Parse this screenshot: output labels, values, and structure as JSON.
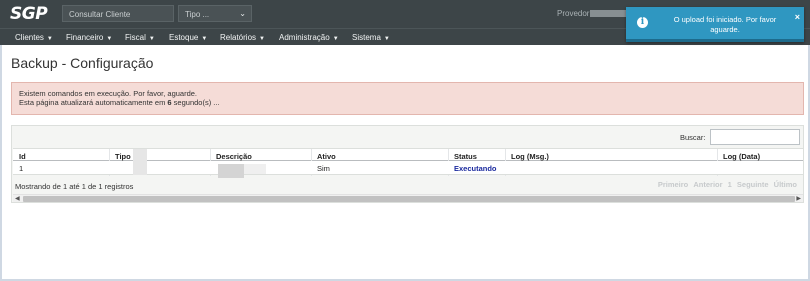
{
  "app": {
    "logo": "SGP",
    "search_placeholder": "Consultar Cliente",
    "tipo_select": "Tipo ...",
    "provedor_label": "Provedor"
  },
  "menu": [
    {
      "label": "Clientes"
    },
    {
      "label": "Financeiro"
    },
    {
      "label": "Fiscal"
    },
    {
      "label": "Estoque"
    },
    {
      "label": "Relatórios"
    },
    {
      "label": "Administração"
    },
    {
      "label": "Sistema"
    }
  ],
  "page": {
    "title": "Backup - Configuração"
  },
  "alert": {
    "line1": "Existem comandos em execução. Por favor, aguarde.",
    "line2_prefix": "Esta página atualizará automaticamente em ",
    "seconds": "6",
    "line2_suffix": " segundo(s) ..."
  },
  "table": {
    "search_label": "Buscar:",
    "columns": [
      "Id",
      "Tipo",
      "Descrição",
      "Ativo",
      "Status",
      "Log (Msg.)",
      "Log (Data)"
    ],
    "rows": [
      {
        "id": "1",
        "tipo": "",
        "descricao": "",
        "ativo": "Sim",
        "status": "Executando",
        "log_msg": "",
        "log_data": ""
      }
    ],
    "info": "Mostrando de 1 até 1 de 1 registros",
    "pagination": {
      "first": "Primeiro",
      "previous": "Anterior",
      "page": "1",
      "next": "Seguinte",
      "last": "Último"
    }
  },
  "toast": {
    "message": "O upload foi iniciado. Por favor aguarde.",
    "icon": "info-icon",
    "close": "×"
  },
  "colors": {
    "topbar": "#3d4548",
    "alert_bg": "#f5dcd7",
    "toast_bg": "#2f97c1",
    "status_running": "#1b2a9e"
  }
}
